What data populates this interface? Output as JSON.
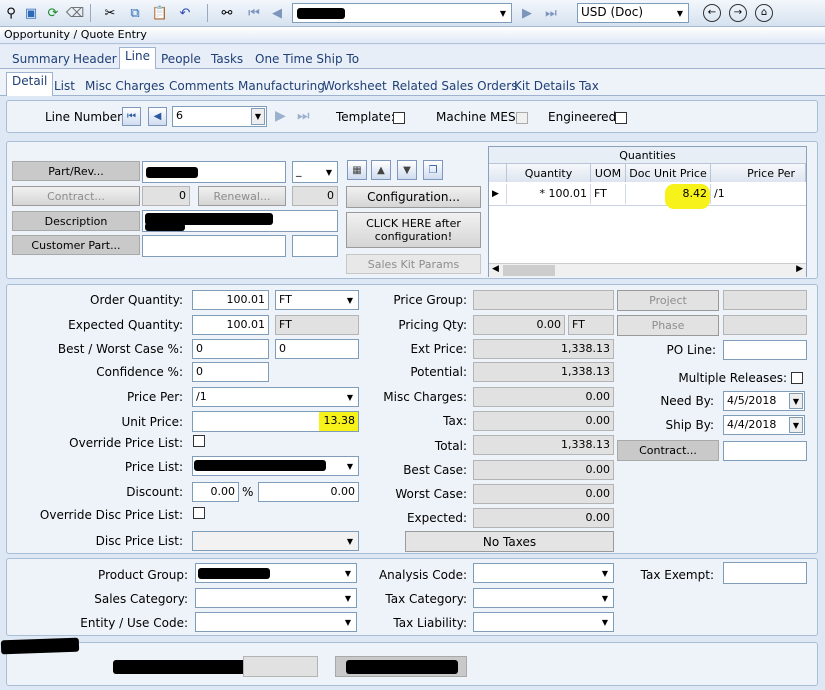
{
  "toolbar": {
    "currency": "USD (Doc)",
    "icons": [
      "pin-icon",
      "copy-icon",
      "refresh-icon",
      "eraser-icon",
      "cut-icon",
      "copy-doc-icon",
      "paste-icon",
      "undo-icon",
      "binoculars-icon",
      "first-icon",
      "prev-icon",
      "next-icon",
      "last-icon",
      "back-icon",
      "forward-icon",
      "home-icon"
    ]
  },
  "title": "Opportunity / Quote Entry",
  "tabs": [
    "Summary",
    "Header",
    "Line",
    "People",
    "Tasks",
    "One Time Ship To"
  ],
  "subtabs": [
    "Detail",
    "List",
    "Misc Charges",
    "Comments",
    "Manufacturing",
    "Worksheet",
    "Related Sales Orders",
    "Kit Details",
    "Tax"
  ],
  "line": {
    "number_label": "Line Number:",
    "number": "6",
    "template_label": "Template:",
    "machine_mes_label": "Machine MES:",
    "engineered_label": "Engineered:"
  },
  "part": {
    "part_rev_btn": "Part/Rev...",
    "rev_value": "_",
    "contract_btn": "Contract...",
    "contract_value": "0",
    "renewal_btn": "Renewal...",
    "renewal_value": "0",
    "description_btn": "Description",
    "customer_part_btn": "Customer Part...",
    "configuration_btn": "Configuration...",
    "click_here_btn_line1": "CLICK HERE after",
    "click_here_btn_line2": "configuration!",
    "sales_kit_btn": "Sales Kit Params"
  },
  "quantities": {
    "title": "Quantities",
    "columns": [
      "Quantity",
      "UOM",
      "Doc Unit Price",
      "Price Per"
    ],
    "row": {
      "marker": "*",
      "quantity": "100.01",
      "uom": "FT",
      "doc_unit_price": "8.42",
      "price_per": "/1"
    }
  },
  "detail": {
    "order_qty_label": "Order Quantity:",
    "order_qty": "100.01",
    "order_qty_uom": "FT",
    "expected_qty_label": "Expected Quantity:",
    "expected_qty": "100.01",
    "expected_qty_uom": "FT",
    "best_worst_label": "Best / Worst Case %:",
    "best_case": "0",
    "worst_case": "0",
    "confidence_label": "Confidence %:",
    "confidence": "0",
    "price_per_label": "Price Per:",
    "price_per": "/1",
    "unit_price_label": "Unit Price:",
    "unit_price": "13.38",
    "override_price_list_label": "Override Price List:",
    "price_list_label": "Price List:",
    "discount_label": "Discount:",
    "discount_pct": "0.00",
    "percent_sign": "%",
    "discount_amt": "0.00",
    "override_disc_label": "Override Disc Price List:",
    "disc_price_list_label": "Disc Price List:"
  },
  "pricing": {
    "price_group_label": "Price Group:",
    "pricing_qty_label": "Pricing Qty:",
    "pricing_qty": "0.00",
    "pricing_qty_uom": "FT",
    "ext_price_label": "Ext Price:",
    "ext_price": "1,338.13",
    "potential_label": "Potential:",
    "potential": "1,338.13",
    "misc_charges_label": "Misc Charges:",
    "misc_charges": "0.00",
    "tax_label": "Tax:",
    "tax": "0.00",
    "total_label": "Total:",
    "total": "1,338.13",
    "best_case_label": "Best Case:",
    "best_case": "0.00",
    "worst_case_label": "Worst Case:",
    "worst_case": "0.00",
    "expected_label": "Expected:",
    "expected": "0.00",
    "no_taxes_btn": "No Taxes"
  },
  "right": {
    "project_btn": "Project",
    "phase_btn": "Phase",
    "po_line_label": "PO Line:",
    "multiple_releases_label": "Multiple Releases:",
    "need_by_label": "Need By:",
    "need_by": "4/5/2018",
    "ship_by_label": "Ship By:",
    "ship_by": "4/4/2018",
    "contract_btn": "Contract..."
  },
  "bottom": {
    "product_group_label": "Product Group:",
    "sales_category_label": "Sales Category:",
    "entity_use_code_label": "Entity / Use Code:",
    "analysis_code_label": "Analysis Code:",
    "tax_category_label": "Tax Category:",
    "tax_liability_label": "Tax Liability:",
    "tax_exempt_label": "Tax Exempt:"
  }
}
